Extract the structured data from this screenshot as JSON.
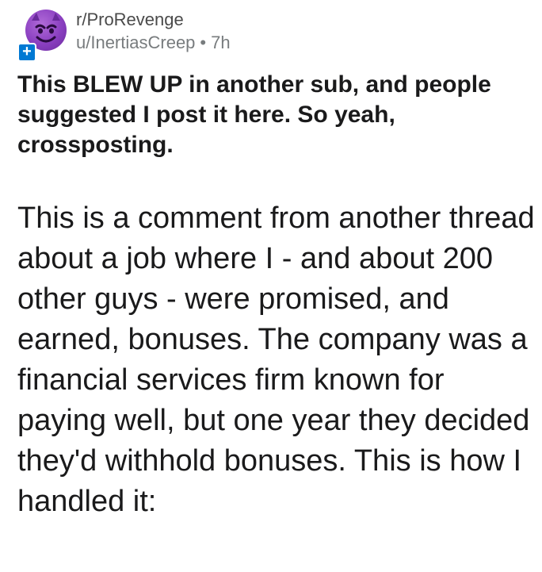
{
  "post": {
    "subreddit": "r/ProRevenge",
    "author": "u/InertiasCreep",
    "separator": "•",
    "age": "7h",
    "join_icon": "plus-icon",
    "join_label": "+",
    "avatar_icon": "devil-face-icon",
    "title": "This BLEW UP in another sub, and people suggested I post it here. So yeah, crossposting.",
    "body": "This is a comment from another thread about a job where I - and about 200 other guys - were promised, and earned, bonuses. The company was a financial services firm known for paying well, but one year they decided they'd withhold bonuses.  This is how I handled it:"
  },
  "colors": {
    "avatar": "#8a3fc0",
    "join_button": "#0079d3",
    "text": "#1a1a1b",
    "meta": "#787c7e"
  }
}
